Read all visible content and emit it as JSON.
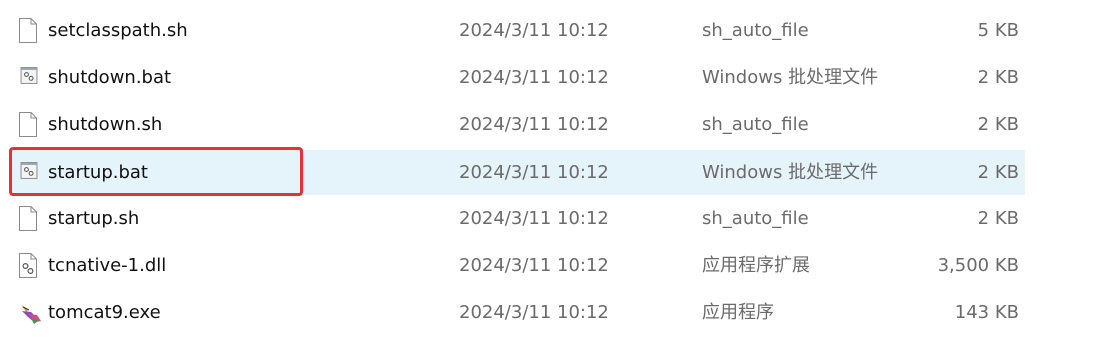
{
  "files": [
    {
      "name": "setclasspath.sh",
      "date": "2024/3/11 10:12",
      "type": "sh_auto_file",
      "size": "5 KB",
      "icon": "blank-file-icon",
      "selected": false
    },
    {
      "name": "shutdown.bat",
      "date": "2024/3/11 10:12",
      "type": "Windows 批处理文件",
      "size": "2 KB",
      "icon": "batch-file-icon",
      "selected": false
    },
    {
      "name": "shutdown.sh",
      "date": "2024/3/11 10:12",
      "type": "sh_auto_file",
      "size": "2 KB",
      "icon": "blank-file-icon",
      "selected": false
    },
    {
      "name": "startup.bat",
      "date": "2024/3/11 10:12",
      "type": "Windows 批处理文件",
      "size": "2 KB",
      "icon": "batch-file-icon",
      "selected": true
    },
    {
      "name": "startup.sh",
      "date": "2024/3/11 10:12",
      "type": "sh_auto_file",
      "size": "2 KB",
      "icon": "blank-file-icon",
      "selected": false
    },
    {
      "name": "tcnative-1.dll",
      "date": "2024/3/11 10:12",
      "type": "应用程序扩展",
      "size": "3,500 KB",
      "icon": "dll-file-icon",
      "selected": false
    },
    {
      "name": "tomcat9.exe",
      "date": "2024/3/11 10:12",
      "type": "应用程序",
      "size": "143 KB",
      "icon": "tomcat-exe-icon",
      "selected": false
    }
  ],
  "colors": {
    "selection_bg": "#e5f3fb",
    "annotation_red": "#e63232"
  }
}
